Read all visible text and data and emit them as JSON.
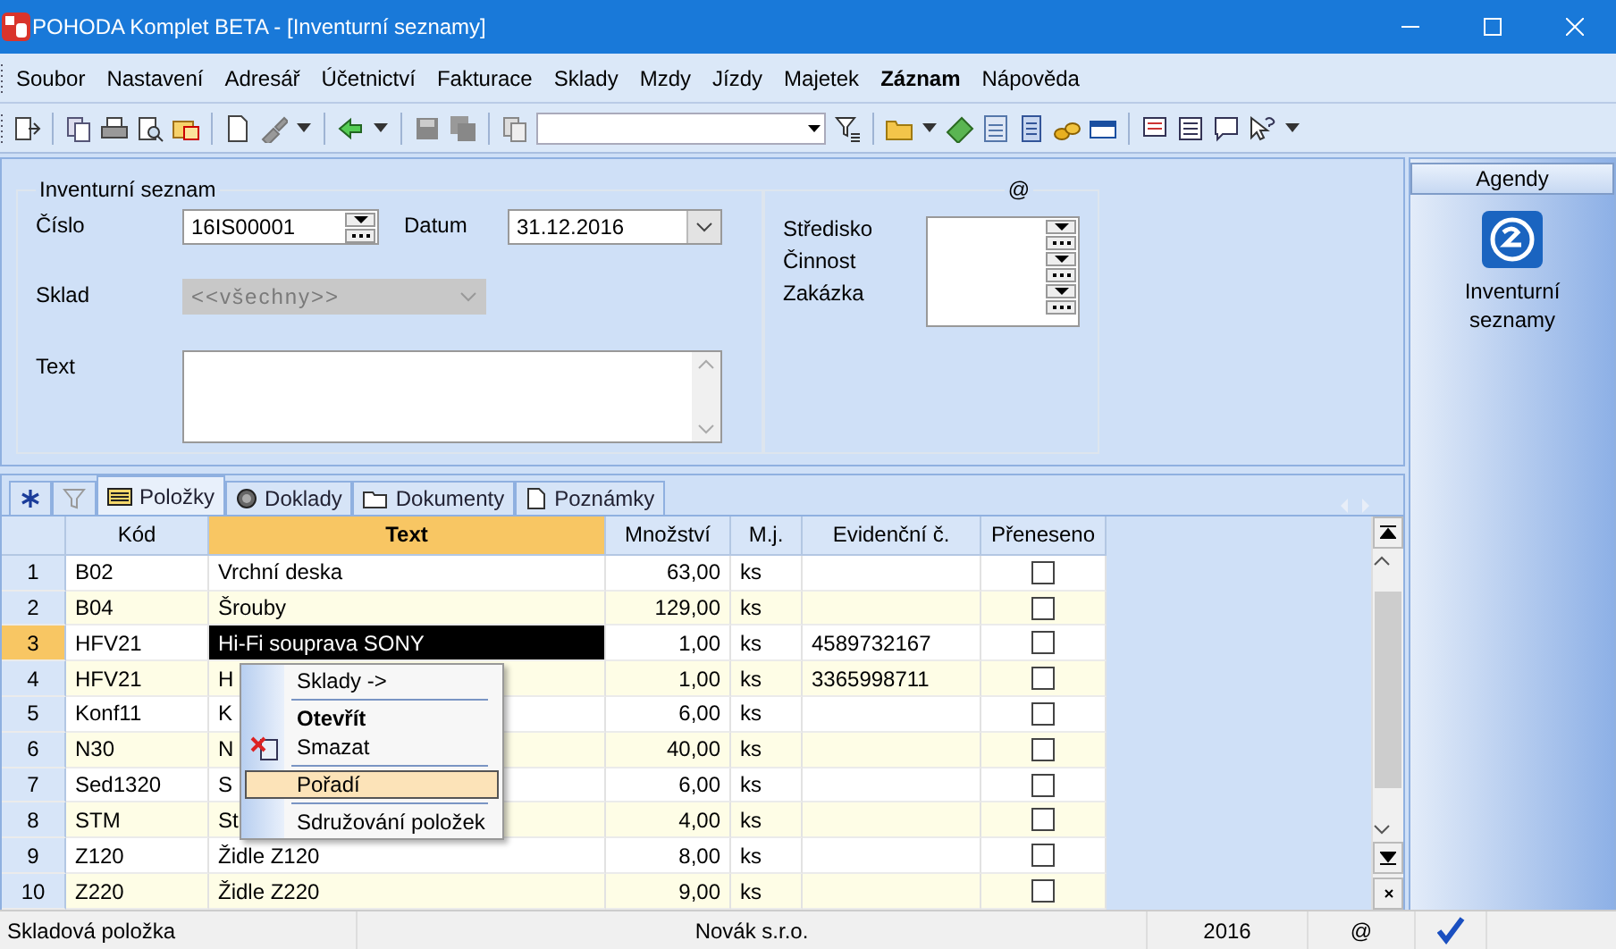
{
  "window": {
    "title": "POHODA Komplet BETA - [Inventurní seznamy]"
  },
  "menu": [
    {
      "label": "Soubor",
      "bold": false
    },
    {
      "label": "Nastavení",
      "bold": false
    },
    {
      "label": "Adresář",
      "bold": false
    },
    {
      "label": "Účetnictví",
      "bold": false
    },
    {
      "label": "Fakturace",
      "bold": false
    },
    {
      "label": "Sklady",
      "bold": false
    },
    {
      "label": "Mzdy",
      "bold": false
    },
    {
      "label": "Jízdy",
      "bold": false
    },
    {
      "label": "Majetek",
      "bold": false
    },
    {
      "label": "Záznam",
      "bold": true
    },
    {
      "label": "Nápověda",
      "bold": false
    }
  ],
  "form": {
    "group_title": "Inventurní seznam",
    "number": {
      "label": "Číslo",
      "value": "16IS00001"
    },
    "date": {
      "label": "Datum",
      "value": "31.12.2016"
    },
    "store": {
      "label": "Sklad",
      "value": "<<všechny>>",
      "disabled": true
    },
    "text": {
      "label": "Text"
    },
    "extra_group_title": "@",
    "extra_fields": [
      {
        "label": "Středisko"
      },
      {
        "label": "Činnost"
      },
      {
        "label": "Zakázka"
      }
    ]
  },
  "tabs": [
    {
      "kind": "new",
      "selected": false
    },
    {
      "kind": "filter",
      "selected": false
    },
    {
      "kind": "list",
      "label": "Položky",
      "selected": true
    },
    {
      "kind": "coin",
      "label": "Doklady",
      "selected": false
    },
    {
      "kind": "folder",
      "label": "Dokumenty",
      "selected": false
    },
    {
      "kind": "note",
      "label": "Poznámky",
      "selected": false
    }
  ],
  "grid": {
    "columns": [
      {
        "sorted": false
      },
      {
        "label": "Kód",
        "sorted": false
      },
      {
        "label": "Text",
        "sorted": true
      },
      {
        "label": "Množství",
        "sorted": false
      },
      {
        "label": "M.j.",
        "sorted": false
      },
      {
        "label": "Evidenční č.",
        "sorted": false
      },
      {
        "label": "Přeneseno",
        "sorted": false
      }
    ],
    "rows": [
      {
        "number": "1",
        "code": "B02",
        "text": "Vrchní deska",
        "quantity": "63,00",
        "unit": "ks",
        "transferred": false,
        "selected": false
      },
      {
        "number": "2",
        "code": "B04",
        "text": "Šrouby",
        "quantity": "129,00",
        "unit": "ks",
        "transferred": false,
        "selected": false
      },
      {
        "number": "3",
        "code": "HFV21",
        "text": "Hi-Fi souprava SONY",
        "quantity": "1,00",
        "unit": "ks",
        "serial": "4589732167",
        "transferred": false,
        "selected": true
      },
      {
        "number": "4",
        "code": "HFV21",
        "text": "H",
        "quantity": "1,00",
        "unit": "ks",
        "serial": "3365998711",
        "transferred": false,
        "selected": false
      },
      {
        "number": "5",
        "code": "Konf11",
        "text": "K",
        "quantity": "6,00",
        "unit": "ks",
        "transferred": false,
        "selected": false
      },
      {
        "number": "6",
        "code": "N30",
        "text": "N",
        "quantity": "40,00",
        "unit": "ks",
        "transferred": false,
        "selected": false
      },
      {
        "number": "7",
        "code": "Sed1320",
        "text": "S",
        "quantity": "6,00",
        "unit": "ks",
        "transferred": false,
        "selected": false
      },
      {
        "number": "8",
        "code": "STM",
        "text": "St",
        "quantity": "4,00",
        "unit": "ks",
        "transferred": false,
        "selected": false
      },
      {
        "number": "9",
        "code": "Z120",
        "text": "Židle Z120",
        "quantity": "8,00",
        "unit": "ks",
        "transferred": false,
        "selected": false
      },
      {
        "number": "10",
        "code": "Z220",
        "text": "Židle Z220",
        "quantity": "9,00",
        "unit": "ks",
        "transferred": false,
        "selected": false
      }
    ]
  },
  "context_menu": [
    {
      "kind": "item",
      "label": "Sklady ->",
      "bold": false,
      "selected": false,
      "icon": false
    },
    {
      "kind": "separator"
    },
    {
      "kind": "item",
      "label": "Otevřít",
      "bold": true,
      "selected": false,
      "icon": false
    },
    {
      "kind": "item",
      "label": "Smazat",
      "bold": false,
      "selected": false,
      "icon": true
    },
    {
      "kind": "separator"
    },
    {
      "kind": "item",
      "label": "Pořadí",
      "bold": false,
      "selected": true,
      "icon": false
    },
    {
      "kind": "separator"
    },
    {
      "kind": "item",
      "label": "Sdružování položek",
      "bold": false,
      "selected": false,
      "icon": false
    }
  ],
  "agendas": {
    "title": "Agendy",
    "items": [
      {
        "label": "Inventurní seznamy"
      }
    ]
  },
  "status_bar": [
    {
      "kind": "text",
      "text": "Skladová položka"
    },
    {
      "kind": "text",
      "text": "Novák s.r.o."
    },
    {
      "kind": "text",
      "text": "2016"
    },
    {
      "kind": "text",
      "text": "@"
    },
    {
      "kind": "check"
    }
  ]
}
